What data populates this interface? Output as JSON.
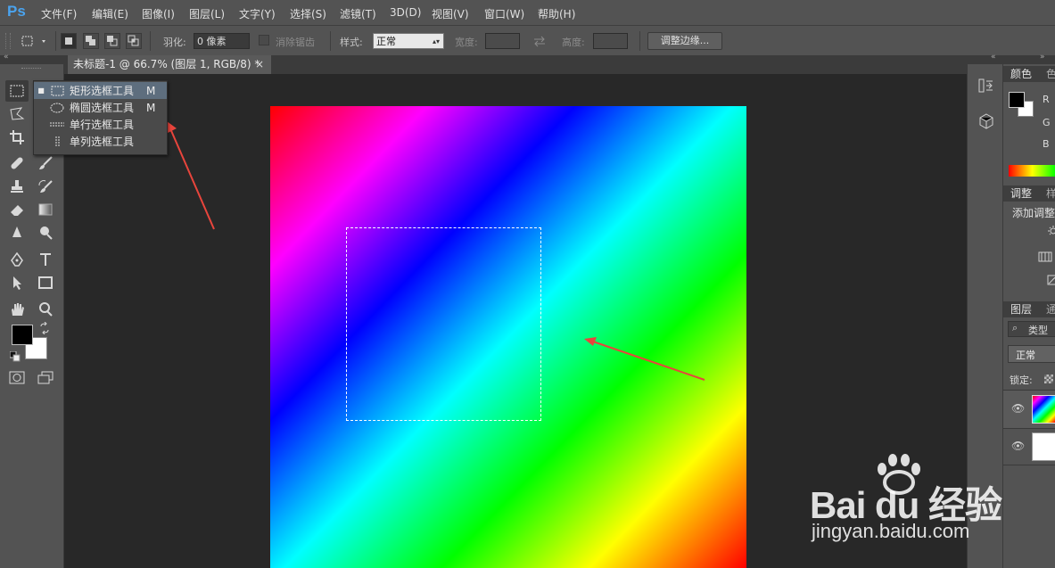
{
  "app": {
    "logo": "Ps"
  },
  "menu": [
    "文件(F)",
    "编辑(E)",
    "图像(I)",
    "图层(L)",
    "文字(Y)",
    "选择(S)",
    "滤镜(T)",
    "3D(D)",
    "视图(V)",
    "窗口(W)",
    "帮助(H)"
  ],
  "options": {
    "feather_label": "羽化:",
    "feather_value": "0 像素",
    "antialias_label": "消除锯齿",
    "style_label": "样式:",
    "style_value": "正常",
    "width_label": "宽度:",
    "height_label": "高度:",
    "refine_edge_button": "调整边缘..."
  },
  "document": {
    "tab_title": "未标题-1 @ 66.7% (图层 1, RGB/8) *",
    "close_glyph": "×"
  },
  "tool_flyout": {
    "items": [
      {
        "label": "矩形选框工具",
        "shortcut": "M",
        "selected": true,
        "icon": "rect-marquee-icon"
      },
      {
        "label": "椭圆选框工具",
        "shortcut": "M",
        "selected": false,
        "icon": "ellipse-marquee-icon"
      },
      {
        "label": "单行选框工具",
        "shortcut": "",
        "selected": false,
        "icon": "single-row-marquee-icon"
      },
      {
        "label": "单列选框工具",
        "shortcut": "",
        "selected": false,
        "icon": "single-column-marquee-icon"
      }
    ]
  },
  "panels": {
    "color_tab": "颜色",
    "swatch_tab": "色",
    "color_channels": [
      "R",
      "G",
      "B"
    ],
    "adjust_tab": "调整",
    "styles_tab": "样",
    "add_adjustment": "添加调整",
    "layers_tab": "图层",
    "channels_tab": "通",
    "filter_kind": "类型",
    "blend_mode": "正常",
    "lock_label": "锁定:"
  },
  "watermark": {
    "brand": "Bai du 经验",
    "url": "jingyan.baidu.com"
  },
  "colors": {
    "accent": "#4aa3ee",
    "annotation": "#e8453c",
    "panel": "#535353",
    "canvas_bg": "#282828"
  }
}
